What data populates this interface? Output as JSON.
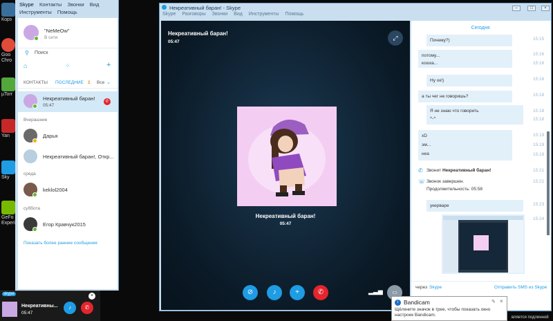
{
  "desktop": {
    "icons": [
      {
        "label": "Корз",
        "color": "#3a6f9c"
      },
      {
        "label": "Goo Chro",
        "color": "#e04b3a"
      },
      {
        "label": "µTorr",
        "color": "#52a83a"
      },
      {
        "label": "Yan",
        "color": "#c62828"
      },
      {
        "label": "Sky",
        "color": "#1e9ce4"
      },
      {
        "label": "GeFo Experi",
        "color": "#76b900"
      }
    ]
  },
  "main_window": {
    "title": "Skype",
    "menu": [
      "Skype",
      "Контакты",
      "Звонки",
      "Вид"
    ],
    "menu2": [
      "Инструменты",
      "Помощь"
    ],
    "profile": {
      "name": "\"NeMeOw\"",
      "status": "В сети"
    },
    "search_placeholder": "Поиск",
    "tabs": {
      "contacts": "КОНТАКТЫ",
      "recent": "ПОСЛЕДНИЕ",
      "recent_badge": "1",
      "filter": "Все"
    },
    "active_item": {
      "name": "Некреативный баран!",
      "time": "05:47"
    },
    "sections": {
      "yesterday": "Вчерашние",
      "wednesday": "среда",
      "saturday": "суббота"
    },
    "items": {
      "darya": "Дарья",
      "group": "Некреативный баран!, Откр...",
      "keklol": "keklol2004",
      "egor": "Егор Кравчук2015"
    },
    "show_older": "Показать более ранние сообщения"
  },
  "call_window": {
    "title": "Некреативный баран! - Skype",
    "menu": [
      "Skype",
      "Разговоры",
      "Звонки",
      "Вид",
      "Инструменты",
      "Помощь"
    ],
    "caller_name": "Некреативный баран!",
    "call_duration": "05:47"
  },
  "chat": {
    "today": "Сегодня",
    "messages": [
      {
        "text": "Почему?)",
        "time": "15:15"
      },
      {
        "text": "потому...",
        "time": "15:16"
      },
      {
        "text": "ксюха...",
        "time": "15:16"
      },
      {
        "text": "Ну ок!)",
        "time": "15:16"
      },
      {
        "text": "а ты чег не говоришь?",
        "time": "15:18"
      },
      {
        "text": "Я не знаю что говорить",
        "time": "15:18"
      },
      {
        "text": "^-^",
        "time": "15:18"
      },
      {
        "text": "xD",
        "time": "15:19"
      },
      {
        "text": "эм...",
        "time": "15:19"
      },
      {
        "text": "неа",
        "time": "15:19"
      },
      {
        "text": "укерваре",
        "time": "15:23"
      }
    ],
    "event_call_prefix": "Звонит ",
    "event_call_name": "Некреативный баран!",
    "event_call_time": "15:21",
    "event_end": "Звонок завершен.",
    "event_duration": "Продолжительность: 05:58",
    "event_end_time": "15:21",
    "screenshot_time": "15:24",
    "via": "через",
    "via_skype": "Skype",
    "send_sms": "Отправить SMS из Skype"
  },
  "mini_bar": {
    "name": "Некреативны...",
    "time": "05:47",
    "logo": "skype"
  },
  "toast": {
    "title": "Bandicam",
    "text": "Щёлкните значок в трее, чтобы показать окно настроек Bandicam.",
    "behind": "вляется подлинной"
  }
}
